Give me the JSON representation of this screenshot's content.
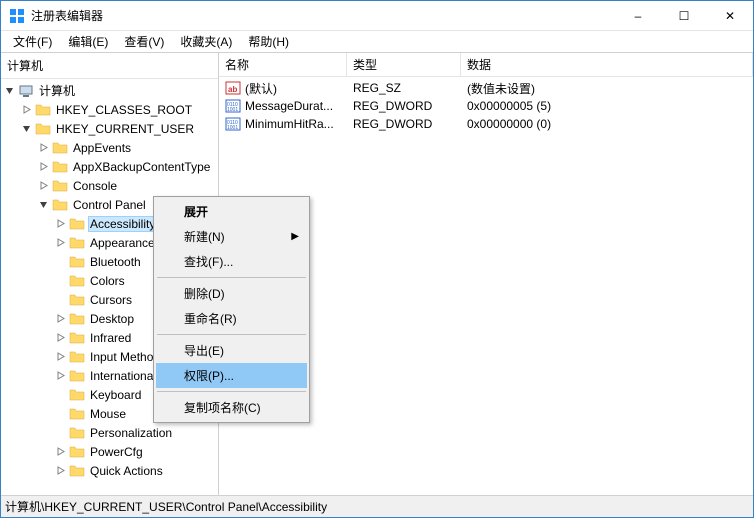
{
  "title": "注册表编辑器",
  "window_buttons": {
    "min": "–",
    "max": "☐",
    "close": "✕"
  },
  "menubar": [
    "文件(F)",
    "编辑(E)",
    "查看(V)",
    "收藏夹(A)",
    "帮助(H)"
  ],
  "tree_header": "计算机",
  "tree": {
    "root": "计算机",
    "hives": [
      {
        "label": "HKEY_CLASSES_ROOT",
        "exp": "closed"
      },
      {
        "label": "HKEY_CURRENT_USER",
        "exp": "open",
        "children": [
          {
            "label": "AppEvents",
            "exp": "closed"
          },
          {
            "label": "AppXBackupContentType",
            "exp": "closed"
          },
          {
            "label": "Console",
            "exp": "closed"
          },
          {
            "label": "Control Panel",
            "exp": "open",
            "children": [
              {
                "label": "Accessibility",
                "exp": "closed",
                "selected": true
              },
              {
                "label": "Appearance",
                "exp": "closed"
              },
              {
                "label": "Bluetooth",
                "exp": "none"
              },
              {
                "label": "Colors",
                "exp": "none"
              },
              {
                "label": "Cursors",
                "exp": "none"
              },
              {
                "label": "Desktop",
                "exp": "closed"
              },
              {
                "label": "Infrared",
                "exp": "closed"
              },
              {
                "label": "Input Method",
                "exp": "closed"
              },
              {
                "label": "International",
                "exp": "closed"
              },
              {
                "label": "Keyboard",
                "exp": "none"
              },
              {
                "label": "Mouse",
                "exp": "none"
              },
              {
                "label": "Personalization",
                "exp": "none"
              },
              {
                "label": "PowerCfg",
                "exp": "closed"
              },
              {
                "label": "Quick Actions",
                "exp": "closed"
              }
            ]
          }
        ]
      }
    ]
  },
  "list_cols": {
    "name": "名称",
    "type": "类型",
    "data": "数据"
  },
  "list_rows": [
    {
      "icon": "string",
      "name": "(默认)",
      "type": "REG_SZ",
      "data": "(数值未设置)"
    },
    {
      "icon": "binary",
      "name": "MessageDurat...",
      "type": "REG_DWORD",
      "data": "0x00000005 (5)"
    },
    {
      "icon": "binary",
      "name": "MinimumHitRa...",
      "type": "REG_DWORD",
      "data": "0x00000000 (0)"
    }
  ],
  "ctx": {
    "expand": "展开",
    "new": "新建(N)",
    "find": "查找(F)...",
    "delete": "删除(D)",
    "rename": "重命名(R)",
    "export": "导出(E)",
    "perm": "权限(P)...",
    "copyname": "复制项名称(C)"
  },
  "statusbar": "计算机\\HKEY_CURRENT_USER\\Control Panel\\Accessibility"
}
